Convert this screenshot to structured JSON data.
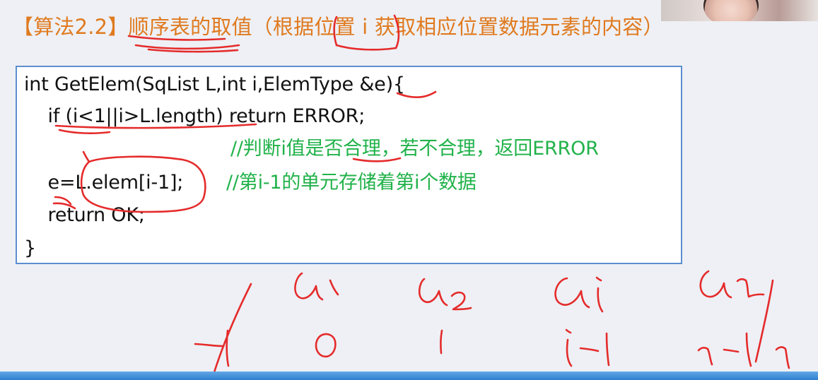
{
  "slide": {
    "title": "【算法2.2】顺序表的取值（根据位置 i 获取相应位置数据元素的内容）"
  },
  "code": {
    "lines": [
      {
        "code": "int GetElem(SqList L,int i,ElemType &e){",
        "comment": ""
      },
      {
        "code": "    if (i<1||i>L.length) return ERROR;",
        "comment": ""
      },
      {
        "code": "",
        "comment": "//判断i值是否合理，若不合理，返回ERROR"
      },
      {
        "code": "    e=L.elem[i-1];",
        "comment": "//第i-1的单元存储着第i个数据"
      },
      {
        "code": "    return OK;",
        "comment": ""
      },
      {
        "code": "}",
        "comment": ""
      }
    ]
  },
  "colors": {
    "title": "#e07a1f",
    "comment": "#21b24a",
    "ink": "#e52b2b",
    "box_border": "#5b8fd0",
    "background": "#eef0f5"
  }
}
